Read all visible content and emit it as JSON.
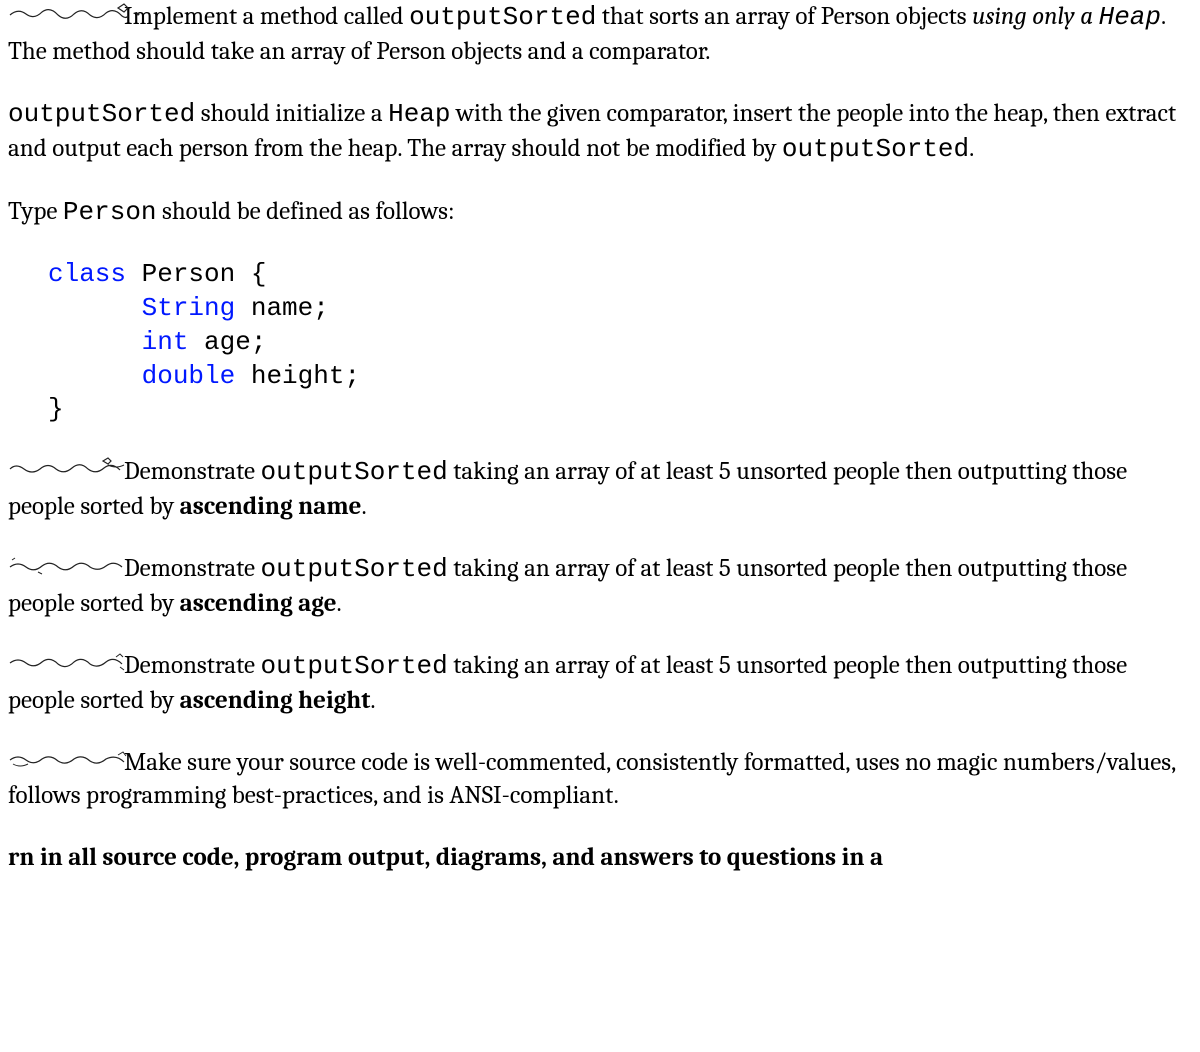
{
  "p1": {
    "t1": "Implement a method called ",
    "code1": "outputSorted",
    "t2": " that sorts an array of Person objects ",
    "italic1": "using only a ",
    "codeItalic1": "Heap",
    "t3": ".  The method should take an array of Person objects and a comparator."
  },
  "p2": {
    "code1": "outputSorted",
    "t1": " should initialize a ",
    "code2": "Heap",
    "t2": " with the given comparator, insert the people into the heap, then extract and output each person from the heap.  The array should not be modified by ",
    "code3": "outputSorted",
    "t3": "."
  },
  "p3": {
    "t1": "Type ",
    "code1": "Person",
    "t2": " should be defined as follows:"
  },
  "code": {
    "kw_class": "class",
    "cls": " Person {",
    "indent": "      ",
    "kw_string": "String",
    "name": " name;",
    "kw_int": "int",
    "age": " age;",
    "kw_double": "double",
    "height": " height;",
    "close": "}"
  },
  "p4": {
    "t1": "Demonstrate ",
    "code1": "outputSorted",
    "t2": " taking an array of at least 5 unsorted people then outputting those people sorted by ",
    "bold1": "ascending name",
    "t3": "."
  },
  "p5": {
    "t1": "Demonstrate ",
    "code1": "outputSorted",
    "t2": " taking an array of at least 5 unsorted people then outputting those people sorted by ",
    "bold1": "ascending age",
    "t3": "."
  },
  "p6": {
    "t1": "Demonstrate ",
    "code1": "outputSorted",
    "t2": " taking an array of at least 5 unsorted people then outputting those people sorted by ",
    "bold1": "ascending height",
    "t3": "."
  },
  "p7": {
    "t1": "Make sure your source code is well-commented, consistently formatted, uses no magic numbers/values, follows programming best-practices, and is ANSI-compliant."
  },
  "p8": {
    "t1": "rn in all source code, program output, diagrams, and answers to questions in a"
  }
}
